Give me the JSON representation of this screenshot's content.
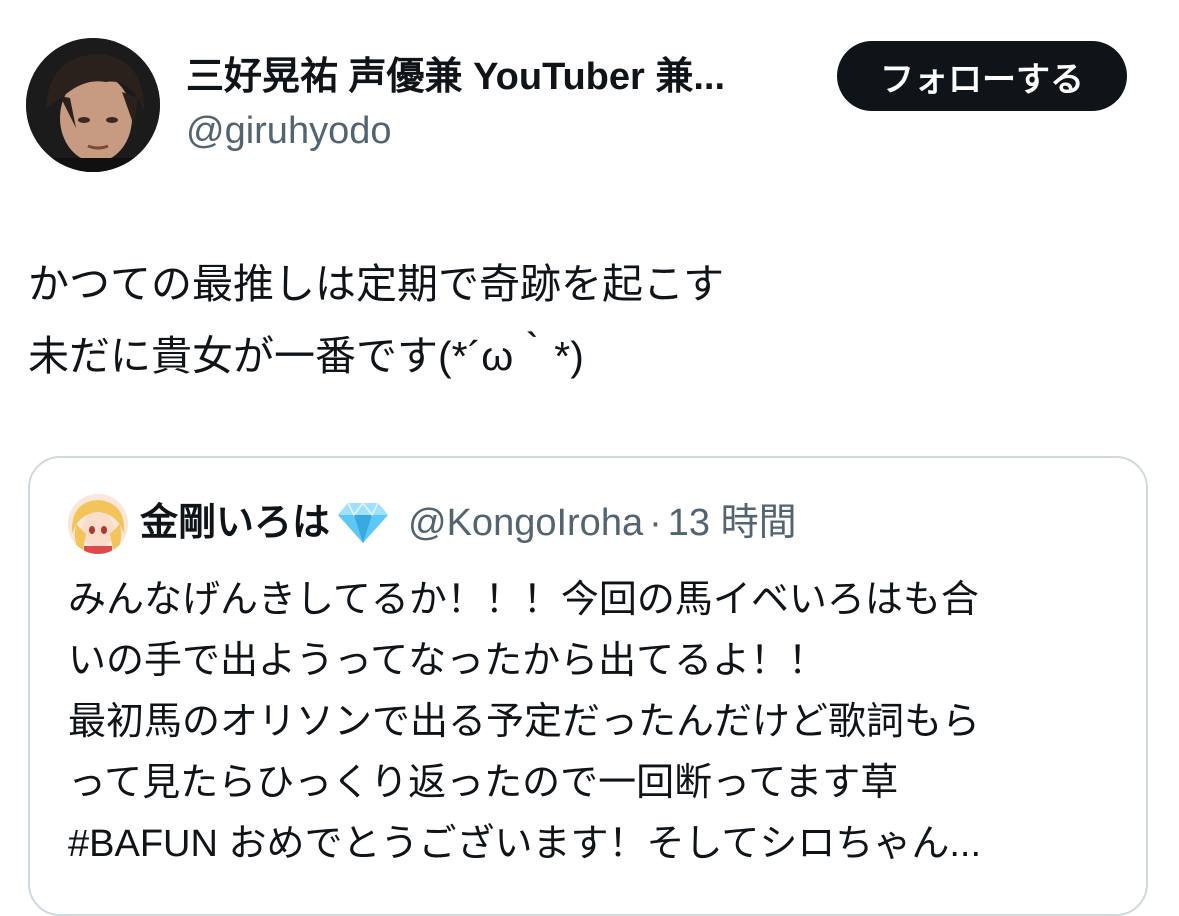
{
  "author": {
    "display_name": "三好晃祐 声優兼 YouTuber 兼...",
    "handle": "@giruhyodo"
  },
  "follow_button": {
    "label": "フォローする"
  },
  "tweet": {
    "lines": [
      "かつての最推しは定期で奇跡を起こす",
      "未だに貴女が一番です(*´ω｀*)"
    ]
  },
  "quoted_tweet": {
    "display_name": "金剛いろは",
    "badge_icon": "diamond-icon",
    "handle": "@KongoIroha",
    "separator": "·",
    "time": "13 時間",
    "lines": [
      "みんなげんきしてるか！！！今回の馬イベいろはも合",
      "いの手で出ようってなったから出てるよ！！",
      "最初馬のオリソンで出る予定だったんだけど歌詞もら",
      "って見たらひっくり返ったので一回断ってます草",
      "#BAFUN おめでとうございます！そしてシロちゃん..."
    ]
  },
  "colors": {
    "text_primary": "#0f1419",
    "text_secondary": "#536471",
    "border": "#cfd9de",
    "button_bg": "#0f1419",
    "button_text": "#ffffff",
    "diamond": "#4fc3f7"
  }
}
